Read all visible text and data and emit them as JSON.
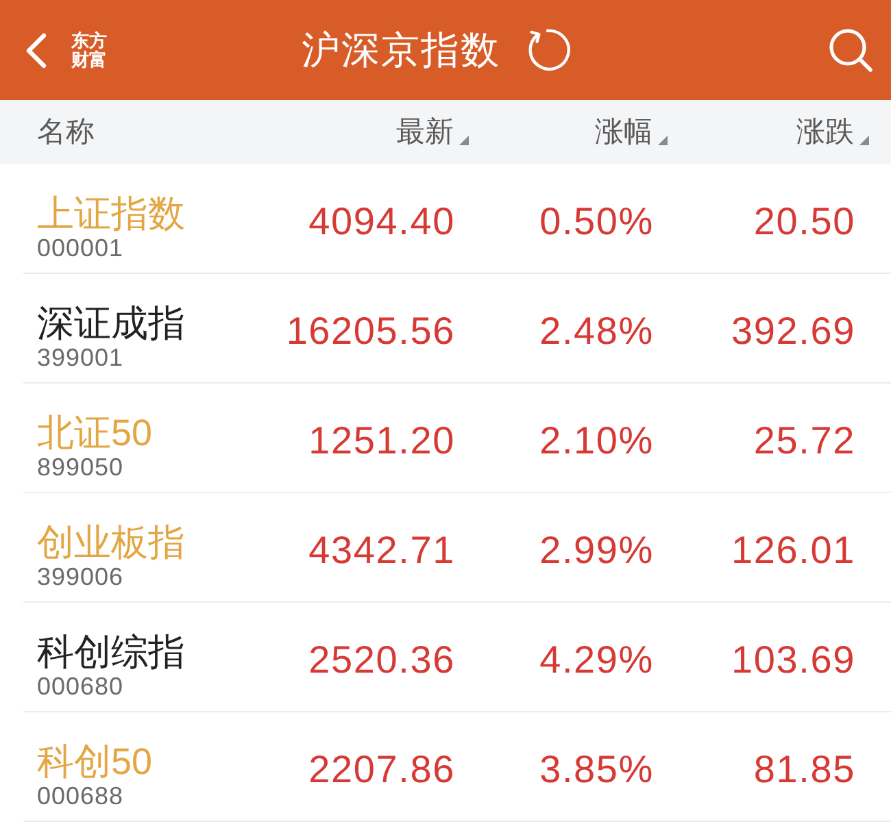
{
  "header": {
    "logo_lines": [
      "东方",
      "财富"
    ],
    "title": "沪深京指数"
  },
  "columns": [
    {
      "label": "名称",
      "sortable": false
    },
    {
      "label": "最新",
      "sortable": true
    },
    {
      "label": "涨幅",
      "sortable": true
    },
    {
      "label": "涨跌",
      "sortable": true
    }
  ],
  "rows": [
    {
      "name": "上证指数",
      "code": "000001",
      "color": "#e2a744",
      "rising": true,
      "price": "4094.40",
      "change_pct": "0.50%",
      "change": "20.50"
    },
    {
      "name": "深证成指",
      "code": "399001",
      "color": "#222222",
      "rising": true,
      "price": "16205.56",
      "change_pct": "2.48%",
      "change": "392.69"
    },
    {
      "name": "北证50",
      "code": "899050",
      "color": "#e2a744",
      "rising": true,
      "price": "1251.20",
      "change_pct": "2.10%",
      "change": "25.72"
    },
    {
      "name": "创业板指",
      "code": "399006",
      "color": "#e2a744",
      "rising": true,
      "price": "4342.71",
      "change_pct": "2.99%",
      "change": "126.01"
    },
    {
      "name": "科创综指",
      "code": "000680",
      "color": "#222222",
      "rising": true,
      "price": "2520.36",
      "change_pct": "4.29%",
      "change": "103.69"
    },
    {
      "name": "科创50",
      "code": "000688",
      "color": "#e2a744",
      "rising": true,
      "price": "2207.86",
      "change_pct": "3.85%",
      "change": "81.85"
    }
  ]
}
